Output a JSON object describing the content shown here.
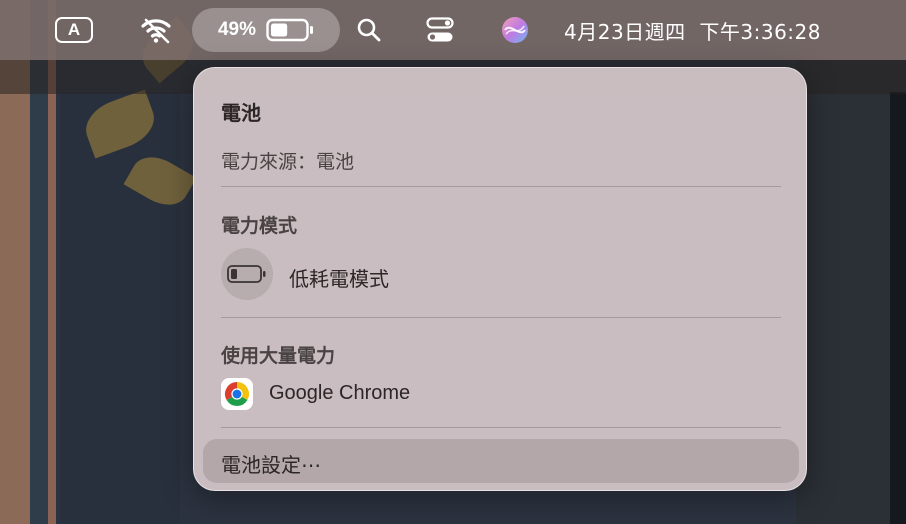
{
  "menubar": {
    "input_source_label": "A",
    "battery_percent": "49%",
    "battery_level": 0.49,
    "clock": "4月23日週四  下午3:36:28",
    "icons": [
      "input-source-icon",
      "wifi-icon",
      "battery-icon",
      "search-icon",
      "control-center-icon",
      "siri-icon"
    ]
  },
  "battery_menu": {
    "title": "電池",
    "power_source": "電力來源：電池",
    "power_mode_header": "電力模式",
    "low_power_mode_label": "低耗電模式",
    "significant_energy_header": "使用大量電力",
    "apps": [
      {
        "name": "Google Chrome",
        "icon": "chrome-icon"
      }
    ],
    "settings_label": "電池設定⋯"
  }
}
